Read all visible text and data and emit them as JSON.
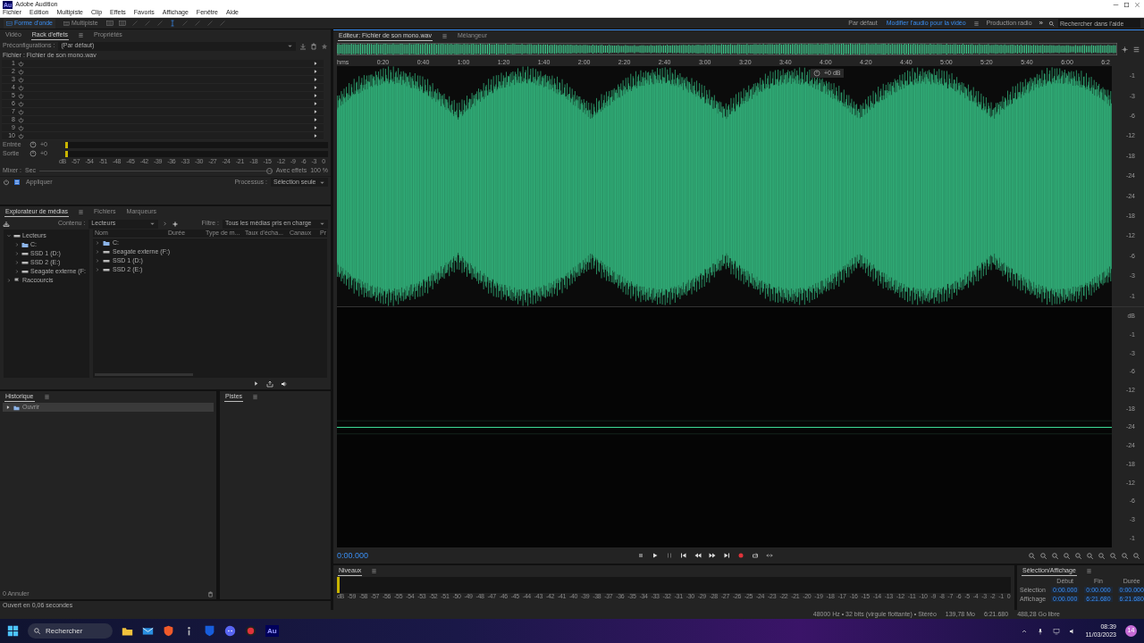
{
  "window": {
    "app_icon": "Au",
    "title": "Adobe Audition"
  },
  "menu": [
    "Fichier",
    "Edition",
    "Multipiste",
    "Clip",
    "Effets",
    "Favoris",
    "Affichage",
    "Fenêtre",
    "Aide"
  ],
  "modes": [
    {
      "label": "Forme d'onde",
      "selected": true
    },
    {
      "label": "Multipiste",
      "selected": false
    }
  ],
  "workspaces": [
    {
      "label": "Par défaut",
      "selected": false
    },
    {
      "label": "Modifier l'audio pour la vidéo",
      "selected": true
    },
    {
      "label": "Production radio",
      "selected": false
    }
  ],
  "overflow": "»",
  "help_search": {
    "placeholder": "Rechercher dans l'aide"
  },
  "effects_panel": {
    "tabs": [
      {
        "label": "Vidéo",
        "selected": false
      },
      {
        "label": "Rack d'effets",
        "selected": true
      },
      {
        "label": "Propriétés",
        "selected": false
      }
    ],
    "preset_label": "Préconfigurations :",
    "preset": "(Par défaut)",
    "file_label": "Fichier : Fichier de son mono.wav",
    "slots": [
      "1",
      "2",
      "3",
      "4",
      "5",
      "6",
      "7",
      "8",
      "9",
      "10"
    ],
    "meters": [
      {
        "label": "Entrée",
        "gain": "+0"
      },
      {
        "label": "Sortie",
        "gain": "+0"
      }
    ],
    "scale": [
      "dB",
      "-57",
      "-54",
      "-51",
      "-48",
      "-45",
      "-42",
      "-39",
      "-36",
      "-33",
      "-30",
      "-27",
      "-24",
      "-21",
      "-18",
      "-15",
      "-12",
      "-9",
      "-6",
      "-3",
      "0"
    ],
    "mix_label": "Mixer :",
    "mix_dry": "Sec",
    "mix_wet": "Avec effets",
    "mix_value": "100 %",
    "mix_slider": {
      "level": 1
    },
    "apply": "Appliquer",
    "process_label": "Processus :",
    "process": "Sélection seule"
  },
  "media_panel": {
    "tabs": [
      {
        "label": "Explorateur de médias",
        "selected": true
      },
      {
        "label": "Fichiers",
        "selected": false
      },
      {
        "label": "Marqueurs",
        "selected": false
      }
    ],
    "content_label": "Contenu :",
    "content": "Lecteurs",
    "filter_label": "Filtre :",
    "filter": "Tous les médias pris en charge",
    "tree": [
      {
        "label": "Lecteurs",
        "kind": "drives",
        "expanded": true,
        "children": [
          {
            "label": "C:",
            "kind": "system"
          },
          {
            "label": "SSD 1 (D:)",
            "kind": "drive"
          },
          {
            "label": "SSD 2 (E:)",
            "kind": "drive"
          },
          {
            "label": "Seagate externe (F:",
            "kind": "drive"
          }
        ]
      },
      {
        "label": "Raccourcis",
        "kind": "shortcuts",
        "expanded": false
      }
    ],
    "columns": [
      "Nom",
      "Durée",
      "Type de m...",
      "Taux d'écha...",
      "Canaux",
      "Pr"
    ],
    "rows": [
      {
        "label": "C:",
        "kind": "system"
      },
      {
        "label": "Seagate externe (F:)",
        "kind": "drive"
      },
      {
        "label": "SSD 1 (D:)",
        "kind": "drive"
      },
      {
        "label": "SSD 2 (E:)",
        "kind": "drive"
      }
    ]
  },
  "history_panel": {
    "title": "Historique",
    "items": [
      {
        "label": "Ouvrir",
        "selected": true
      }
    ],
    "undo": "0 Annuler"
  },
  "tracks_panel": {
    "title": "Pistes"
  },
  "status_left": "Ouvert en 0,06 secondes",
  "editor": {
    "tabs": [
      {
        "label": "Editeur: Fichier de son mono.wav",
        "selected": true
      },
      {
        "label": "Mélangeur",
        "selected": false
      }
    ],
    "ruler": [
      "hms",
      "0:20",
      "0:40",
      "1:00",
      "1:20",
      "1:40",
      "2:00",
      "2:20",
      "2:40",
      "3:00",
      "3:20",
      "3:40",
      "4:00",
      "4:20",
      "4:40",
      "5:00",
      "5:20",
      "5:40",
      "6:00",
      "6:2"
    ],
    "hud_gain": "+0 dB",
    "channels": [
      {
        "scale": [
          "-1",
          "-3",
          "-6",
          "-12",
          "-18",
          "-24",
          "-24",
          "-18",
          "-12",
          "-6",
          "-3",
          "-1"
        ]
      },
      {
        "db_label": "dB",
        "scale": [
          "-1",
          "-3",
          "-6",
          "-12",
          "-18",
          "-24",
          "-24",
          "-18",
          "-12",
          "-6",
          "-3",
          "-1"
        ]
      }
    ],
    "time": "0:00.000"
  },
  "levels_panel": {
    "title": "Niveaux",
    "scale": [
      "dB",
      "-59",
      "-58",
      "-57",
      "-56",
      "-55",
      "-54",
      "-53",
      "-52",
      "-51",
      "-50",
      "-49",
      "-48",
      "-47",
      "-46",
      "-45",
      "-44",
      "-43",
      "-42",
      "-41",
      "-40",
      "-39",
      "-38",
      "-37",
      "-36",
      "-35",
      "-34",
      "-33",
      "-32",
      "-31",
      "-30",
      "-29",
      "-28",
      "-27",
      "-26",
      "-25",
      "-24",
      "-23",
      "-22",
      "-21",
      "-20",
      "-19",
      "-18",
      "-17",
      "-16",
      "-15",
      "-14",
      "-13",
      "-12",
      "-11",
      "-10",
      "-9",
      "-8",
      "-7",
      "-6",
      "-5",
      "-4",
      "-3",
      "-2",
      "-1",
      "0"
    ]
  },
  "selection_panel": {
    "title": "Sélection/Affichage",
    "columns": [
      "Début",
      "Fin",
      "Durée"
    ],
    "rows": [
      {
        "label": "Sélection",
        "values": [
          "0:00.000",
          "0:00.000",
          "0:00.000"
        ]
      },
      {
        "label": "Affichage",
        "values": [
          "0:00.000",
          "6:21.680",
          "6:21.680"
        ]
      }
    ]
  },
  "status_bar": [
    "48000 Hz • 32 bits (virgule flottante) • Stéréo",
    "139,78 Mo",
    "6:21.680",
    "488,28 Go libre"
  ],
  "taskbar": {
    "search": {
      "placeholder": "Rechercher"
    },
    "app_label": "Au",
    "time": "08:39",
    "date": "11/03/2023",
    "notification_count": "14"
  }
}
